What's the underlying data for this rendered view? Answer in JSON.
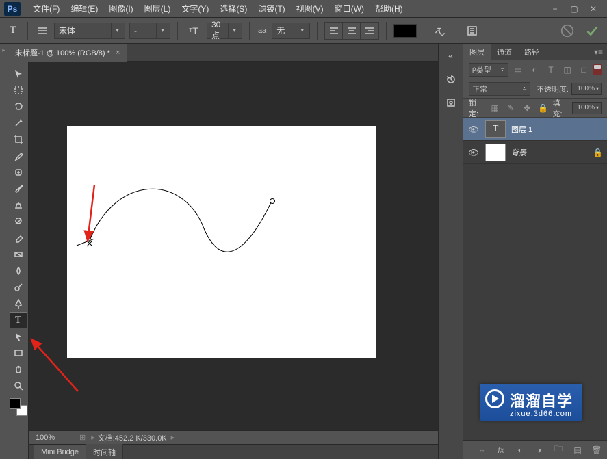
{
  "menu": {
    "file": "文件(F)",
    "edit": "编辑(E)",
    "image": "图像(I)",
    "layer": "图层(L)",
    "type": "文字(Y)",
    "select": "选择(S)",
    "filter": "滤镜(T)",
    "view": "视图(V)",
    "window": "窗口(W)",
    "help": "帮助(H)"
  },
  "logo": "Ps",
  "options": {
    "tool_glyph": "T",
    "font_family": "宋体",
    "font_style": "-",
    "font_size": "30点",
    "aa_label": "aa",
    "aa_value": "无",
    "size_unit_icon": "T"
  },
  "doc": {
    "tab_title": "未标题-1 @ 100% (RGB/8) *",
    "zoom": "100%",
    "status": "文档:452.2 K/330.0K"
  },
  "panels": {
    "tab_layers": "图层",
    "tab_channels": "通道",
    "tab_paths": "路径",
    "kind_label": "类型",
    "blend_mode": "正常",
    "opacity_label": "不透明度:",
    "opacity_value": "100%",
    "lock_label": "锁定:",
    "fill_label": "填充:",
    "fill_value": "100%"
  },
  "layers": [
    {
      "name": "图层 1",
      "type": "T",
      "selected": true
    },
    {
      "name": "背景",
      "type": "bg",
      "locked": true
    }
  ],
  "bottom_tabs": {
    "mini_bridge": "Mini Bridge",
    "timeline": "时间轴"
  },
  "watermark": {
    "title": "溜溜自学",
    "sub": "zixue.3d66.com"
  },
  "filter_kind_glyphs": [
    "▭",
    "T",
    "◫",
    "◐",
    "□"
  ]
}
